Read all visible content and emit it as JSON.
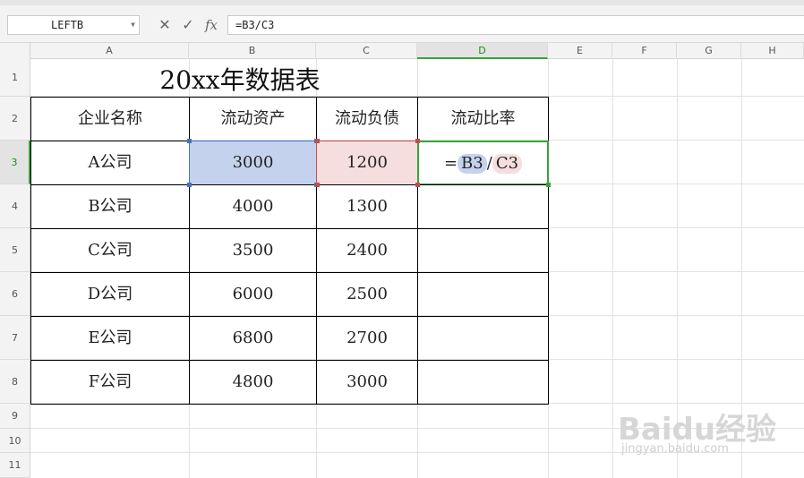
{
  "toolbar": {
    "name_box": "LEFTB",
    "cancel_symbol": "✕",
    "enter_symbol": "✓",
    "fx_label": "fx",
    "formula": "=B3/C3"
  },
  "columns": [
    "A",
    "B",
    "C",
    "D",
    "E",
    "F",
    "G",
    "H"
  ],
  "active_column": "D",
  "rows": [
    "1",
    "2",
    "3",
    "4",
    "5",
    "6",
    "7",
    "8",
    "9",
    "10",
    "11"
  ],
  "active_row": "3",
  "sheet": {
    "title": "20xx年数据表",
    "headers": [
      "企业名称",
      "流动资产",
      "流动负债",
      "流动比率"
    ],
    "records": [
      {
        "company": "A公司",
        "assets": "3000",
        "liabilities": "1200"
      },
      {
        "company": "B公司",
        "assets": "4000",
        "liabilities": "1300"
      },
      {
        "company": "C公司",
        "assets": "3500",
        "liabilities": "2400"
      },
      {
        "company": "D公司",
        "assets": "6000",
        "liabilities": "2500"
      },
      {
        "company": "E公司",
        "assets": "6800",
        "liabilities": "2700"
      },
      {
        "company": "F公司",
        "assets": "4800",
        "liabilities": "3000"
      }
    ],
    "editing_cell": {
      "eq": "=",
      "ref1": "B3",
      "sep": "/",
      "ref2": "C3"
    }
  },
  "colors": {
    "ref1_fill": "#c5d2ee",
    "ref1_border": "#4472c4",
    "ref2_fill": "#f6dede",
    "ref2_border": "#c0504d",
    "active_border": "#3aa23a"
  },
  "watermark": {
    "logo": "Baidu经验",
    "url": "jingyan.baidu.com"
  }
}
